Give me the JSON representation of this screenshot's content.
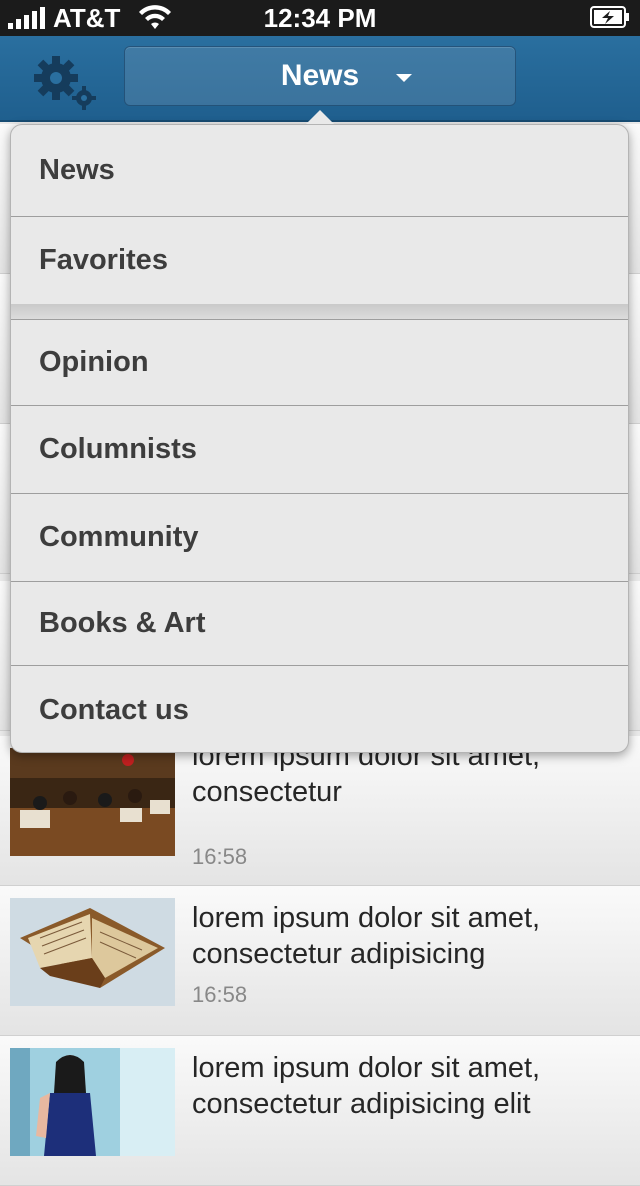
{
  "status_bar": {
    "carrier": "AT&T",
    "time": "12:34 PM"
  },
  "nav": {
    "title": "News"
  },
  "colors": {
    "nav_blue": "#2a6f9f",
    "menu_bg": "#e9e9e9",
    "menu_text": "#3d3d3d"
  },
  "menu": {
    "items": [
      {
        "label": "News"
      },
      {
        "label": "Favorites"
      },
      {
        "label": "Opinion"
      },
      {
        "label": "Columnists"
      },
      {
        "label": "Community"
      },
      {
        "label": "Books & Art"
      },
      {
        "label": "Contact us"
      }
    ]
  },
  "articles": [
    {
      "title": "lorem ipsum dolor sit amet, consectetur",
      "time": "16:58"
    },
    {
      "title": "lorem ipsum dolor sit amet, consectetur adipisicing",
      "time": "16:58"
    },
    {
      "title": "lorem ipsum dolor sit amet, consectetur adipisicing elit",
      "time": ""
    }
  ]
}
